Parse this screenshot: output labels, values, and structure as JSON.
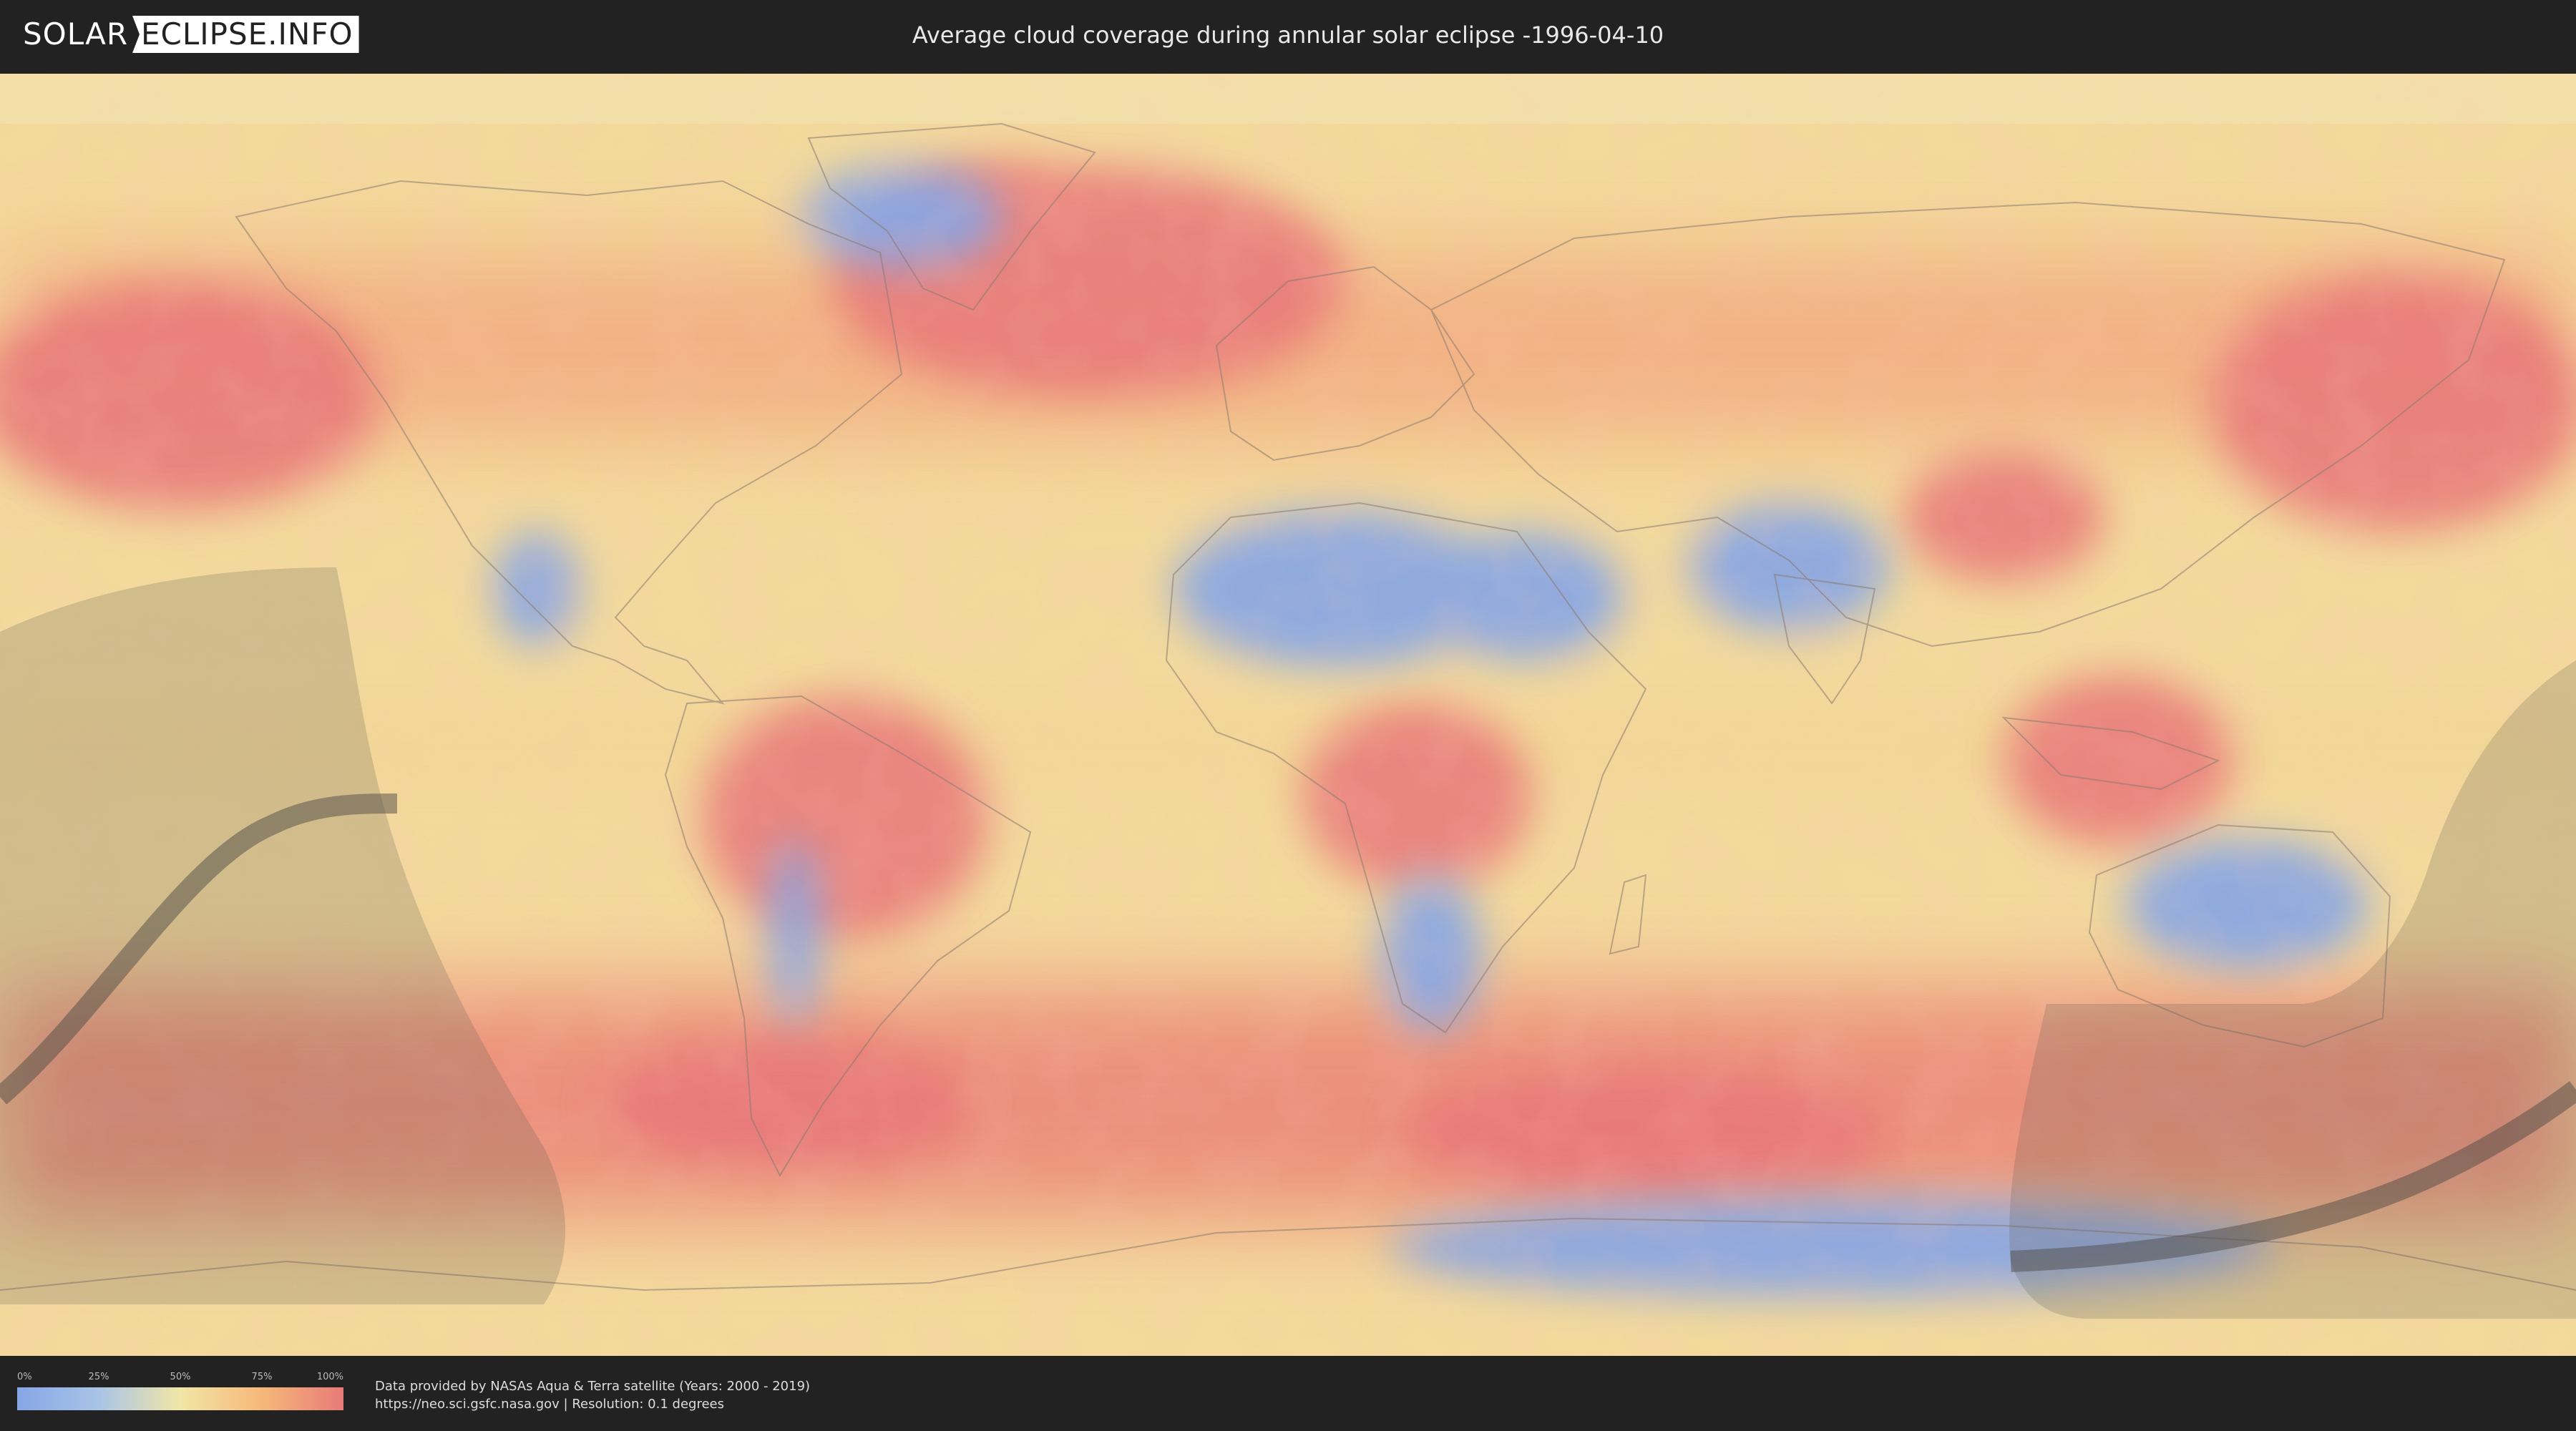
{
  "header": {
    "logo_left": "SOLAR",
    "logo_right": "ECLIPSE.INFO",
    "title": "Average cloud coverage during annular solar eclipse -1996-04-10"
  },
  "legend": {
    "ticks": [
      "0%",
      "25%",
      "50%",
      "75%",
      "100%"
    ],
    "gradient_colors": [
      "#86a6e6",
      "#a8c4e6",
      "#f2e6a6",
      "#f6b87a",
      "#e87a78"
    ]
  },
  "footer": {
    "line1": "Data provided by NASAs Aqua & Terra satellite (Years: 2000 - 2019)",
    "line2": "https://neo.sci.gsfc.nasa.gov | Resolution: 0.1 degrees"
  },
  "colors": {
    "background": "#222222",
    "cloud_low": "#86a6e6",
    "cloud_mid": "#f2e2a2",
    "cloud_high": "#e87a78",
    "eclipse_shadow": "#5a5a52"
  }
}
